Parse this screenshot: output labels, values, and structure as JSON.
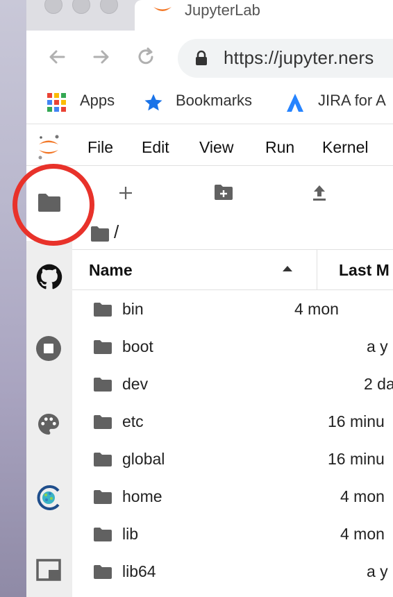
{
  "browser": {
    "tab_title": "JupyterLab",
    "url": "https://jupyter.ners",
    "bookmarks": [
      {
        "label": "Apps",
        "icon": "apps-grid-icon"
      },
      {
        "label": "Bookmarks",
        "icon": "star-icon"
      },
      {
        "label": "JIRA for A",
        "icon": "jira-icon"
      }
    ]
  },
  "menu": {
    "items": [
      "File",
      "Edit",
      "View",
      "Run",
      "Kernel"
    ]
  },
  "filebrowser": {
    "breadcrumb": "/",
    "columns": {
      "name": "Name",
      "last_modified": "Last M"
    },
    "sort_column": "Name",
    "rows": [
      {
        "name": "bin",
        "modified": "4 mon"
      },
      {
        "name": "boot",
        "modified": "a y"
      },
      {
        "name": "dev",
        "modified": "2 da"
      },
      {
        "name": "etc",
        "modified": "16 minu"
      },
      {
        "name": "global",
        "modified": "16 minu"
      },
      {
        "name": "home",
        "modified": "4 mon"
      },
      {
        "name": "lib",
        "modified": "4 mon"
      },
      {
        "name": "lib64",
        "modified": "a y"
      }
    ]
  },
  "sidebar_icons": [
    "folder-icon",
    "github-icon",
    "stop-circle-icon",
    "palette-icon",
    "extension-logo-icon",
    "tab-window-icon"
  ],
  "colors": {
    "annotation": "#e8322a",
    "jupyter_orange": "#f37726",
    "bookmark_star": "#1a73e8"
  }
}
